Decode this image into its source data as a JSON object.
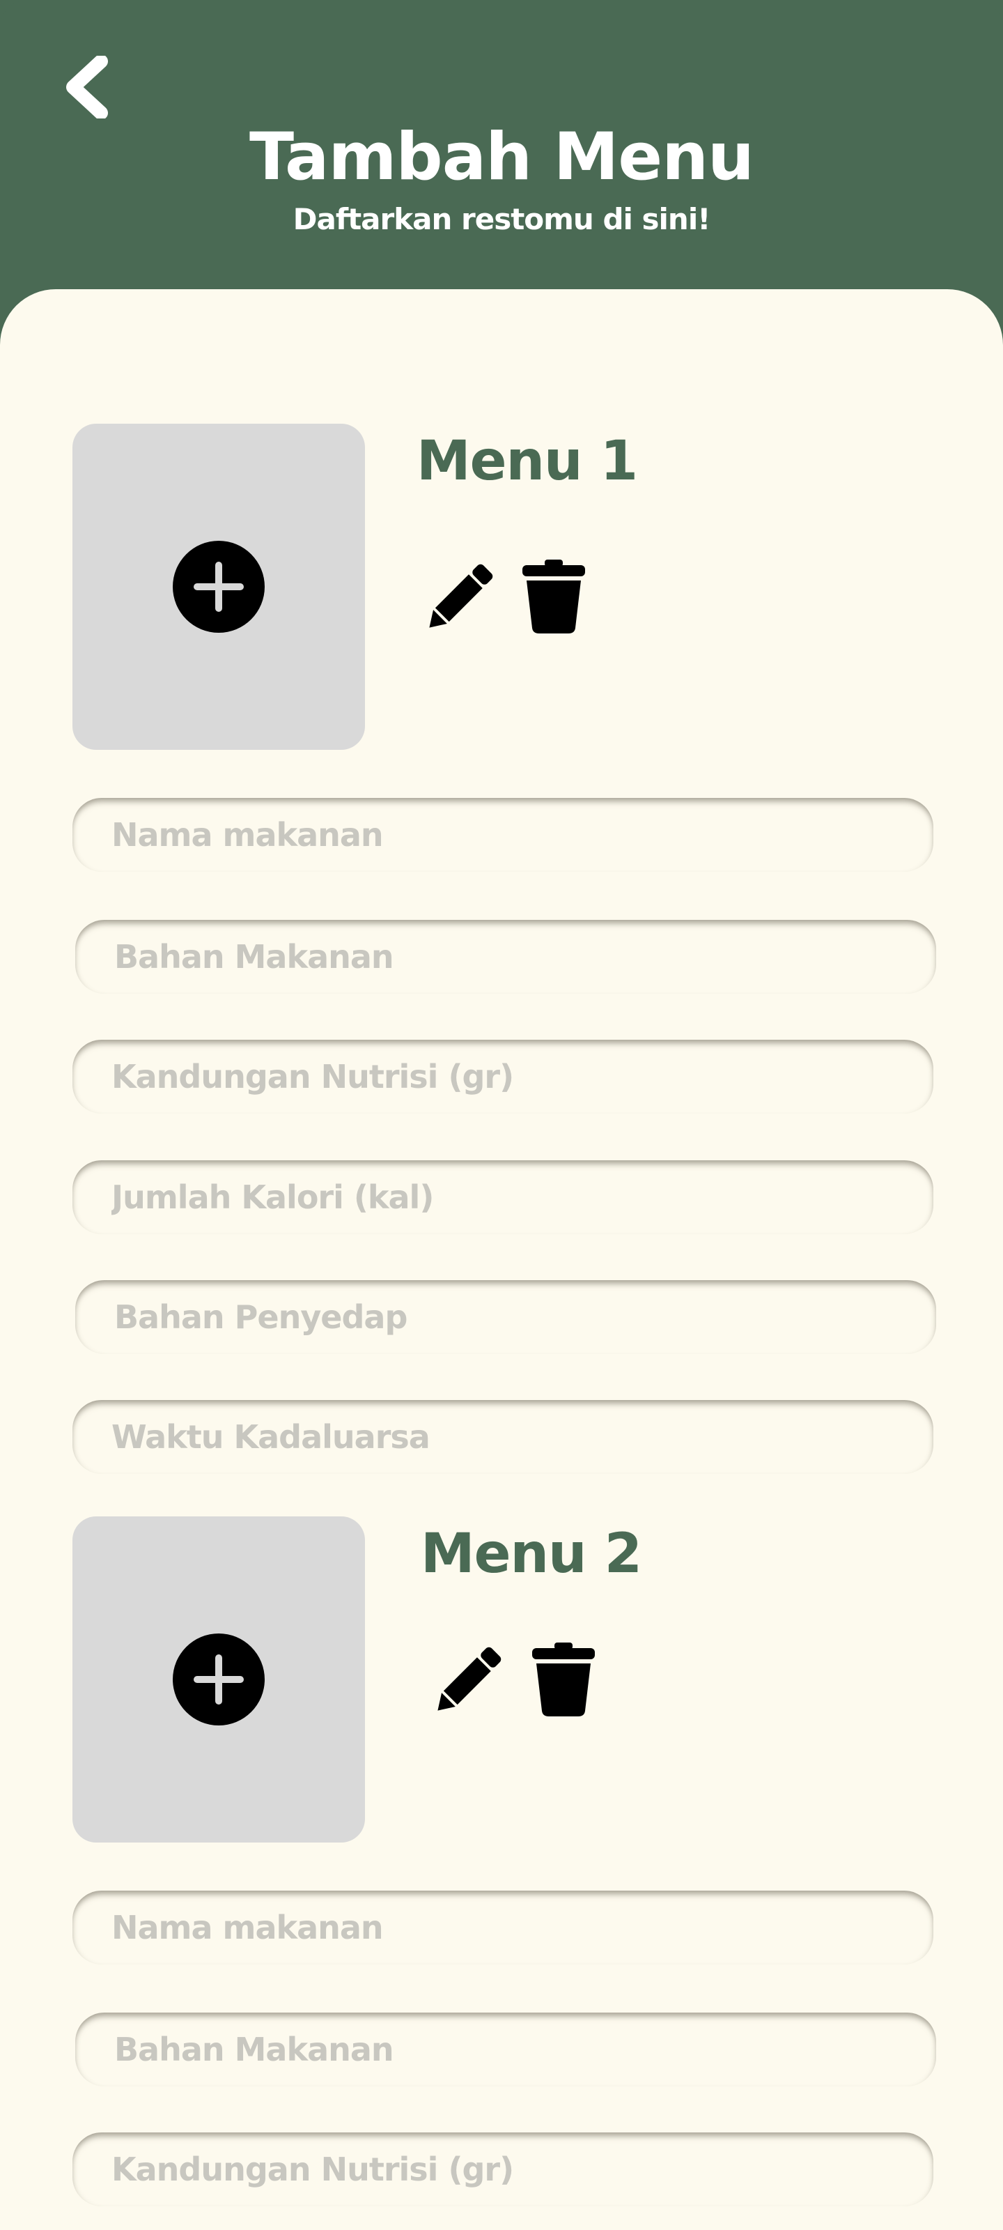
{
  "header": {
    "title": "Tambah Menu",
    "subtitle": "Daftarkan restomu di sini!",
    "back_icon": "chevron-left-icon"
  },
  "colors": {
    "primary": "#4a6a54",
    "background": "#fdfaee",
    "photo_placeholder": "#d9d9d9",
    "input_placeholder": "#c8c7c0"
  },
  "menus": [
    {
      "title": "Menu 1",
      "add_photo_icon": "plus-circle-icon",
      "edit_icon": "pencil-icon",
      "delete_icon": "trash-icon",
      "fields": [
        {
          "placeholder": "Nama makanan",
          "value": ""
        },
        {
          "placeholder": "Bahan Makanan",
          "value": ""
        },
        {
          "placeholder": "Kandungan Nutrisi (gr)",
          "value": ""
        },
        {
          "placeholder": "Jumlah Kalori (kal)",
          "value": ""
        },
        {
          "placeholder": "Bahan Penyedap",
          "value": ""
        },
        {
          "placeholder": "Waktu Kadaluarsa",
          "value": ""
        }
      ]
    },
    {
      "title": "Menu 2",
      "add_photo_icon": "plus-circle-icon",
      "edit_icon": "pencil-icon",
      "delete_icon": "trash-icon",
      "fields": [
        {
          "placeholder": "Nama makanan",
          "value": ""
        },
        {
          "placeholder": "Bahan Makanan",
          "value": ""
        },
        {
          "placeholder": "Kandungan Nutrisi (gr)",
          "value": ""
        }
      ]
    }
  ]
}
